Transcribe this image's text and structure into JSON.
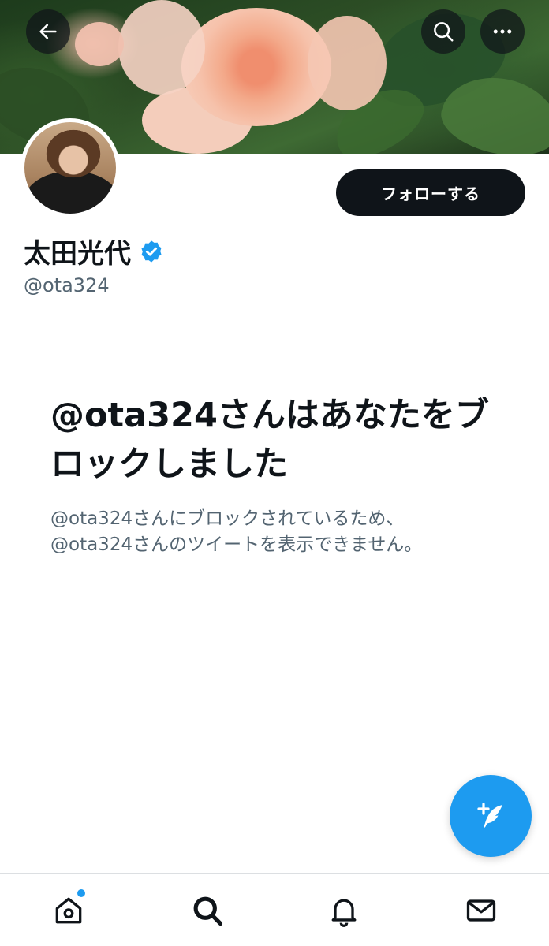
{
  "profile": {
    "display_name": "太田光代",
    "handle": "@ota324",
    "verified": true,
    "follow_label": "フォローする"
  },
  "notice": {
    "title": "@ota324さんはあなたをブロックしました",
    "body_line1": "@ota324さんにブロックされているため、",
    "body_line2": "@ota324さんのツイートを表示できません。"
  },
  "header_icons": [
    "back-arrow-icon",
    "search-icon",
    "more-icon"
  ],
  "nav": {
    "items": [
      {
        "name": "home",
        "icon": "home-icon",
        "has_notification_dot": true
      },
      {
        "name": "search",
        "icon": "search-icon",
        "active": true
      },
      {
        "name": "notifications",
        "icon": "bell-icon"
      },
      {
        "name": "messages",
        "icon": "envelope-icon"
      }
    ]
  },
  "fab": {
    "icon": "compose-tweet-icon"
  },
  "colors": {
    "accent": "#1d9bf0",
    "text_primary": "#0f1419",
    "text_secondary": "#536471",
    "button_bg": "#0f1419"
  }
}
